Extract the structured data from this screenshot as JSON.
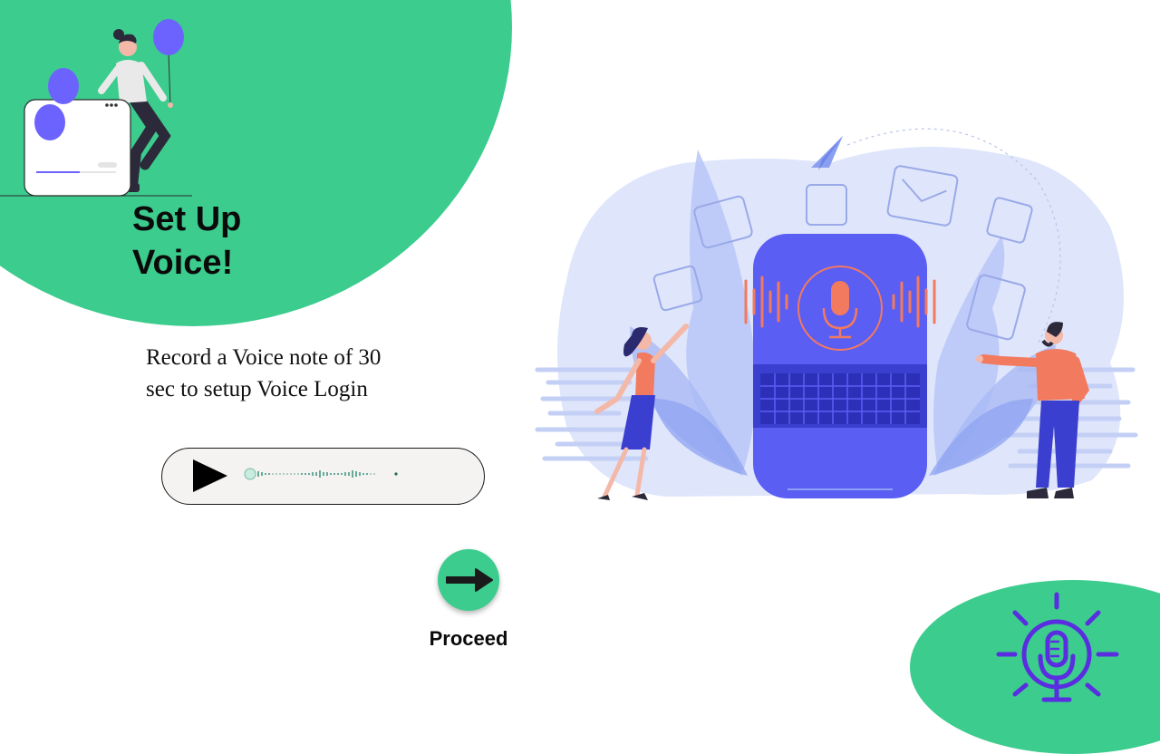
{
  "header": {
    "title_line1": "Set Up",
    "title_line2": "Voice!"
  },
  "description": {
    "line1": "Record a Voice note of 30",
    "line2": "sec to setup Voice Login"
  },
  "player": {
    "state": "paused"
  },
  "proceed": {
    "label": "Proceed"
  },
  "colors": {
    "accent_green": "#3ccc8e",
    "illustration_blue": "#5b5ef3",
    "illustration_light_blue": "#d6def9",
    "coral": "#f27a5e",
    "bulb_purple": "#5a2de0"
  },
  "icons": {
    "play": "play-icon",
    "arrow": "arrow-right-icon",
    "bulb_mic": "lightbulb-microphone-icon"
  }
}
